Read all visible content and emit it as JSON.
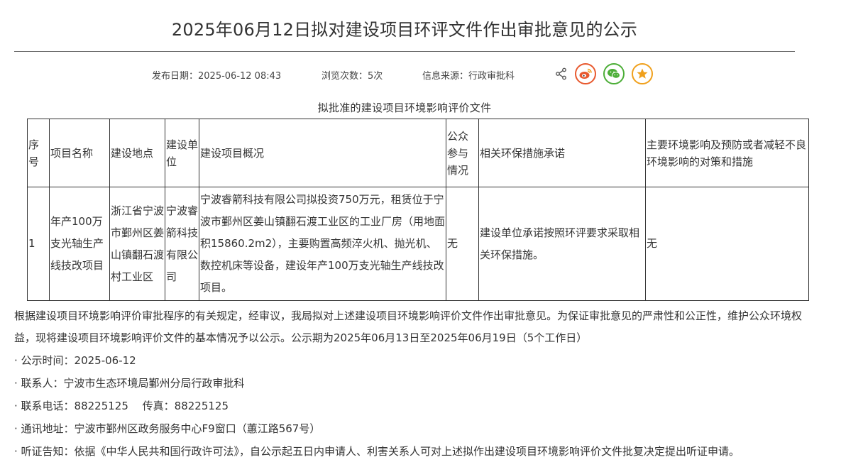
{
  "title": "2025年06月12日拟对建设项目环评文件作出审批意见的公示",
  "meta": {
    "publish": "发布日期：2025-06-12 08:43",
    "views": "浏览次数：5次",
    "source": "信息来源：行政审批科"
  },
  "share": {
    "icons": [
      "share-icon",
      "weibo-icon",
      "wechat-icon",
      "favorite-star-icon"
    ],
    "colors": {
      "weibo": "#e8592e",
      "wechat": "#4cae37",
      "favorite": "#f0a01c"
    }
  },
  "table": {
    "caption": "拟批准的建设项目环境影响评价文件",
    "headers": [
      "序号",
      "项目名称",
      "建设地点",
      "建设单位",
      "建设项目概况",
      "公众参与情况",
      "相关环保措施承诺",
      "主要环境影响及预防或者减轻不良环境影响的对策和措施"
    ],
    "rows": [
      {
        "no": "1",
        "name": "年产100万支光轴生产线技改项目",
        "location": "浙江省宁波市鄞州区姜山镇翻石渡村工业区",
        "unit": "宁波睿箭科技有限公司",
        "overview": "宁波睿箭科技有限公司拟投资750万元，租赁位于宁波市鄞州区姜山镇翻石渡工业区的工业厂房（用地面积15860.2m2），主要购置高频淬火机、抛光机、数控机床等设备，建设年产100万支光轴生产线技改项目。",
        "public": "无",
        "promise": "建设单位承诺按照环评要求采取相关环保措施。",
        "measures": "无"
      }
    ]
  },
  "body": {
    "paragraph": "根据建设项目环境影响评价审批程序的有关规定，经审议，我局拟对上述建设项目环境影响评价文件作出审批意见。为保证审批意见的严肃性和公正性，维护公众环境权益，现将建设项目环境影响评价文件的基本情况予以公示。公示期为2025年06月13日至2025年06月19日（5个工作日）",
    "info": [
      "· 公示时间：2025-06-12",
      "· 联系人：宁波市生态环境局鄞州分局行政审批科",
      "· 联系电话：88225125　 传真：88225125",
      "· 通讯地址：宁波市鄞州区政务服务中心F9窗口（蕙江路567号）",
      "· 听证告知：依据《中华人民共和国行政许可法》，自公示起五日内申请人、利害关系人可对上述拟作出建设项目环境影响评价文件批复决定提出听证申请。"
    ]
  }
}
